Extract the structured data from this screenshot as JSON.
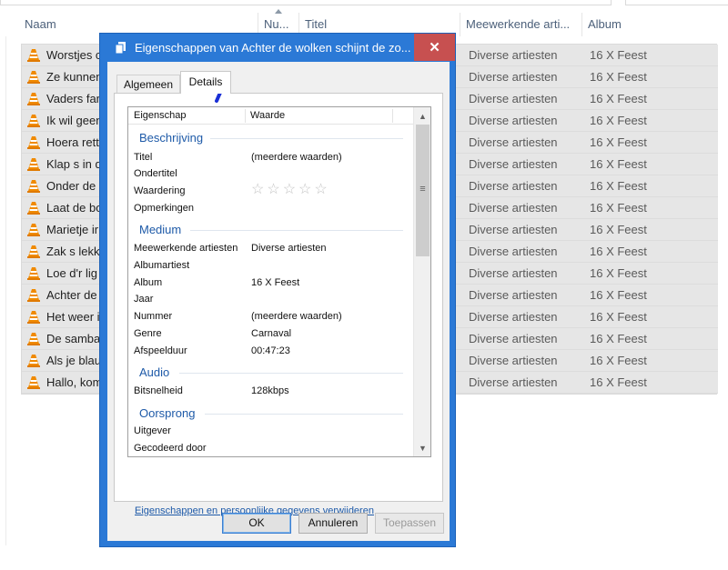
{
  "explorer": {
    "columns": {
      "name": "Naam",
      "number": "Nu...",
      "title": "Titel",
      "artists": "Meewerkende arti...",
      "album": "Album"
    },
    "rows": [
      {
        "name": "Worstjes c",
        "artist": "Diverse artiesten",
        "album": "16 X Feest"
      },
      {
        "name": "Ze kunnen",
        "artist": "Diverse artiesten",
        "album": "16 X Feest"
      },
      {
        "name": "Vaders fan",
        "artist": "Diverse artiesten",
        "album": "16 X Feest"
      },
      {
        "name": "Ik wil geen",
        "artist": "Diverse artiesten",
        "album": "16 X Feest"
      },
      {
        "name": "Hoera rett",
        "artist": "Diverse artiesten",
        "album": "16 X Feest"
      },
      {
        "name": "Klap s in d",
        "artist": "Diverse artiesten",
        "album": "16 X Feest"
      },
      {
        "name": "Onder de",
        "artist": "Diverse artiesten",
        "album": "16 X Feest"
      },
      {
        "name": "Laat de bo",
        "artist": "Diverse artiesten",
        "album": "16 X Feest"
      },
      {
        "name": "Marietje ir",
        "artist": "Diverse artiesten",
        "album": "16 X Feest"
      },
      {
        "name": "Zak s lekk",
        "artist": "Diverse artiesten",
        "album": "16 X Feest"
      },
      {
        "name": "Loe d'r lig",
        "artist": "Diverse artiesten",
        "album": "16 X Feest"
      },
      {
        "name": "Achter de",
        "artist": "Diverse artiesten",
        "album": "16 X Feest"
      },
      {
        "name": "Het weer i",
        "artist": "Diverse artiesten",
        "album": "16 X Feest"
      },
      {
        "name": "De samba",
        "artist": "Diverse artiesten",
        "album": "16 X Feest"
      },
      {
        "name": "Als je blau",
        "artist": "Diverse artiesten",
        "album": "16 X Feest"
      },
      {
        "name": "Hallo, kom",
        "artist": "Diverse artiesten",
        "album": "16 X Feest"
      }
    ]
  },
  "dialog": {
    "title": "Eigenschappen van Achter de wolken schijnt de zo...",
    "close_label": "✕",
    "tabs": {
      "general": "Algemeen",
      "details": "Details"
    },
    "table_head": {
      "property": "Eigenschap",
      "value": "Waarde"
    },
    "groups": {
      "description": "Beschrijving",
      "media": "Medium",
      "audio": "Audio",
      "origin": "Oorsprong"
    },
    "props": {
      "title_label": "Titel",
      "title_value": "(meerdere waarden)",
      "subtitle_label": "Ondertitel",
      "rating_label": "Waardering",
      "rating_value": "☆☆☆☆☆",
      "comments_label": "Opmerkingen",
      "artists_label": "Meewerkende artiesten",
      "artists_value": "Diverse artiesten",
      "albumartist_label": "Albumartiest",
      "album_label": "Album",
      "album_value": "16 X Feest",
      "year_label": "Jaar",
      "track_label": "Nummer",
      "track_value": "(meerdere waarden)",
      "genre_label": "Genre",
      "genre_value": "Carnaval",
      "duration_label": "Afspeelduur",
      "duration_value": "00:47:23",
      "bitrate_label": "Bitsnelheid",
      "bitrate_value": "128kbps",
      "publisher_label": "Uitgever",
      "encoded_label": "Gecodeerd door"
    },
    "remove_link": "Eigenschappen en persoonlijke gegevens verwijderen",
    "buttons": {
      "ok": "OK",
      "cancel": "Annuleren",
      "apply": "Toepassen"
    }
  },
  "colors": {
    "dialog_frame": "#2b79d6",
    "close_button": "#c75050",
    "group_heading": "#1e5aa8",
    "pen_annotation": "#1a2fd6"
  }
}
